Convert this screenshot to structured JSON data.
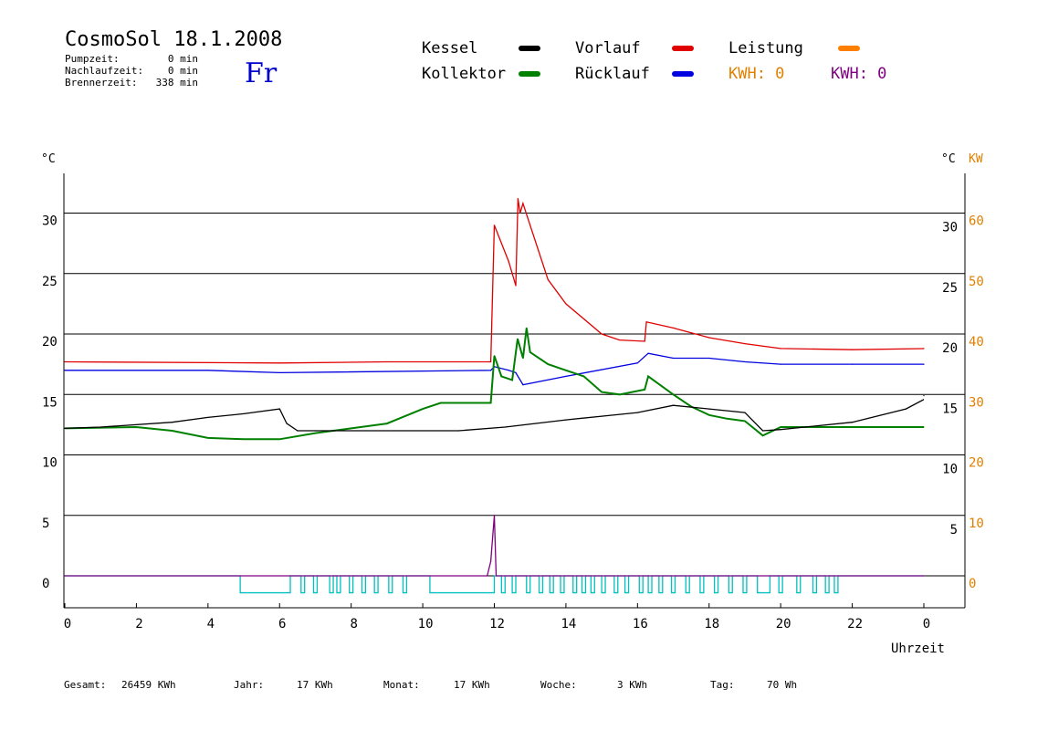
{
  "header": {
    "title": "CosmoSol 18.1.2008",
    "day": "Fr",
    "info": [
      {
        "label": "Pumpzeit:",
        "value": "0 min"
      },
      {
        "label": "Nachlaufzeit:",
        "value": "0 min"
      },
      {
        "label": "Brennerzeit:",
        "value": "338 min"
      }
    ]
  },
  "legend": {
    "items": [
      {
        "label": "Kessel",
        "color": "#000000"
      },
      {
        "label": "Kollektor",
        "color": "#008000"
      },
      {
        "label": "Vorlauf",
        "color": "#e00000"
      },
      {
        "label": "Rücklauf",
        "color": "#0000e0"
      },
      {
        "label": "Leistung",
        "color": "#ff8000"
      }
    ],
    "kwh": [
      {
        "text": "KWH: 0",
        "color": "#e08000"
      },
      {
        "text": "KWH: 0",
        "color": "#800080"
      }
    ]
  },
  "footer": [
    {
      "label": "Gesamt:",
      "value": "26459 KWh"
    },
    {
      "label": "Jahr:",
      "value": "17 KWh"
    },
    {
      "label": "Monat:",
      "value": "17 KWh"
    },
    {
      "label": "Woche:",
      "value": "3 KWh"
    },
    {
      "label": "Tag:",
      "value": "70 Wh"
    }
  ],
  "chart_data": {
    "type": "line",
    "xlabel": "Uhrzeit",
    "x_ticks": [
      "0",
      "2",
      "4",
      "6",
      "8",
      "10",
      "12",
      "14",
      "16",
      "18",
      "20",
      "22",
      "0"
    ],
    "xlim": [
      0,
      24
    ],
    "y_left_unit": "°C",
    "y_right_unit": "°C",
    "y_right2_unit": "KW",
    "ylim": [
      -2.5,
      33
    ],
    "y_left_ticks": [
      "0",
      "5",
      "10",
      "15",
      "20",
      "25",
      "30"
    ],
    "y_right_ticks": [
      "5",
      "10",
      "15",
      "20",
      "25",
      "30"
    ],
    "y_right2_ticks": [
      "0",
      "10",
      "20",
      "30",
      "40",
      "50",
      "60"
    ],
    "grid": "horizontal",
    "series": [
      {
        "name": "Vorlauf",
        "color": "#e00000",
        "points": [
          [
            0,
            17.7
          ],
          [
            6,
            17.6
          ],
          [
            9,
            17.7
          ],
          [
            11.9,
            17.7
          ],
          [
            12.0,
            29.0
          ],
          [
            12.4,
            26.0
          ],
          [
            12.6,
            24.0
          ],
          [
            12.66,
            31.2
          ],
          [
            12.72,
            30.0
          ],
          [
            12.8,
            30.8
          ],
          [
            13.0,
            29.0
          ],
          [
            13.5,
            24.5
          ],
          [
            14,
            22.5
          ],
          [
            15,
            20.0
          ],
          [
            15.5,
            19.5
          ],
          [
            16.2,
            19.4
          ],
          [
            16.25,
            21.0
          ],
          [
            17,
            20.5
          ],
          [
            18,
            19.7
          ],
          [
            19,
            19.2
          ],
          [
            20,
            18.8
          ],
          [
            22,
            18.7
          ],
          [
            25,
            18.8
          ]
        ]
      },
      {
        "name": "Rücklauf",
        "color": "#0000e0",
        "points": [
          [
            0,
            17.0
          ],
          [
            4,
            17.0
          ],
          [
            6,
            16.8
          ],
          [
            11.9,
            17.0
          ],
          [
            12.0,
            17.3
          ],
          [
            12.4,
            17.0
          ],
          [
            12.6,
            16.8
          ],
          [
            12.8,
            15.8
          ],
          [
            14,
            16.5
          ],
          [
            16,
            17.6
          ],
          [
            16.3,
            18.4
          ],
          [
            17,
            18.0
          ],
          [
            18,
            18.0
          ],
          [
            19,
            17.7
          ],
          [
            20,
            17.5
          ],
          [
            22,
            17.5
          ],
          [
            25,
            17.5
          ]
        ]
      },
      {
        "name": "Kollektor",
        "color": "#008000",
        "points": [
          [
            0,
            12.2
          ],
          [
            2,
            12.3
          ],
          [
            3,
            12.0
          ],
          [
            4,
            11.4
          ],
          [
            5,
            11.3
          ],
          [
            6,
            11.3
          ],
          [
            7,
            11.8
          ],
          [
            8,
            12.2
          ],
          [
            9,
            12.6
          ],
          [
            10,
            13.8
          ],
          [
            10.5,
            14.3
          ],
          [
            11.9,
            14.3
          ],
          [
            12.0,
            18.2
          ],
          [
            12.2,
            16.5
          ],
          [
            12.5,
            16.2
          ],
          [
            12.65,
            19.6
          ],
          [
            12.8,
            18.0
          ],
          [
            12.9,
            20.5
          ],
          [
            13,
            18.5
          ],
          [
            13.5,
            17.5
          ],
          [
            14,
            17.0
          ],
          [
            14.5,
            16.5
          ],
          [
            15,
            15.2
          ],
          [
            15.5,
            15.0
          ],
          [
            16.2,
            15.4
          ],
          [
            16.3,
            16.5
          ],
          [
            17,
            15.0
          ],
          [
            17.5,
            14.0
          ],
          [
            18,
            13.3
          ],
          [
            18.5,
            13.0
          ],
          [
            19,
            12.8
          ],
          [
            19.5,
            11.6
          ],
          [
            20,
            12.3
          ],
          [
            22,
            12.3
          ],
          [
            25,
            12.3
          ]
        ]
      },
      {
        "name": "Kessel",
        "color": "#000000",
        "points": [
          [
            0,
            12.2
          ],
          [
            1,
            12.3
          ],
          [
            3,
            12.7
          ],
          [
            4,
            13.1
          ],
          [
            5,
            13.4
          ],
          [
            6,
            13.8
          ],
          [
            6.2,
            12.6
          ],
          [
            6.5,
            12.0
          ],
          [
            7,
            12.0
          ],
          [
            11,
            12.0
          ],
          [
            12.3,
            12.3
          ],
          [
            14,
            12.9
          ],
          [
            15,
            13.2
          ],
          [
            16,
            13.5
          ],
          [
            17,
            14.1
          ],
          [
            18,
            13.8
          ],
          [
            19,
            13.5
          ],
          [
            19.5,
            12.0
          ],
          [
            20,
            12.1
          ],
          [
            22,
            12.7
          ],
          [
            23.5,
            13.8
          ],
          [
            25,
            14.9
          ]
        ]
      },
      {
        "name": "Leistung",
        "color": "#800080",
        "points": [
          [
            0,
            0
          ],
          [
            11.8,
            0
          ],
          [
            11.9,
            1.2
          ],
          [
            12.0,
            5.0
          ],
          [
            12.05,
            0
          ],
          [
            25,
            0
          ]
        ]
      }
    ],
    "pump_pulses": {
      "color": "#00c0c0",
      "low": -1.4,
      "high": 0,
      "segments": [
        [
          4.9,
          6.3
        ],
        [
          6.6,
          6.7
        ],
        [
          6.95,
          7.05
        ],
        [
          7.4,
          7.5
        ],
        [
          7.6,
          7.7
        ],
        [
          7.95,
          8.05
        ],
        [
          8.3,
          8.4
        ],
        [
          8.65,
          8.75
        ],
        [
          9.05,
          9.15
        ],
        [
          9.45,
          9.55
        ],
        [
          10.2,
          12.0
        ],
        [
          12.2,
          12.3
        ],
        [
          12.5,
          12.6
        ],
        [
          12.9,
          13.0
        ],
        [
          13.25,
          13.35
        ],
        [
          13.55,
          13.65
        ],
        [
          13.85,
          13.95
        ],
        [
          14.2,
          14.3
        ],
        [
          14.45,
          14.55
        ],
        [
          14.7,
          14.8
        ],
        [
          15.0,
          15.1
        ],
        [
          15.35,
          15.45
        ],
        [
          15.65,
          15.75
        ],
        [
          16.05,
          16.15
        ],
        [
          16.3,
          16.4
        ],
        [
          16.6,
          16.7
        ],
        [
          16.95,
          17.05
        ],
        [
          17.35,
          17.45
        ],
        [
          17.75,
          17.85
        ],
        [
          18.15,
          18.25
        ],
        [
          18.55,
          18.65
        ],
        [
          18.95,
          19.05
        ],
        [
          19.35,
          19.7
        ],
        [
          19.95,
          20.05
        ],
        [
          20.45,
          20.55
        ],
        [
          20.9,
          21.0
        ],
        [
          21.25,
          21.35
        ],
        [
          21.5,
          21.6
        ]
      ]
    }
  }
}
